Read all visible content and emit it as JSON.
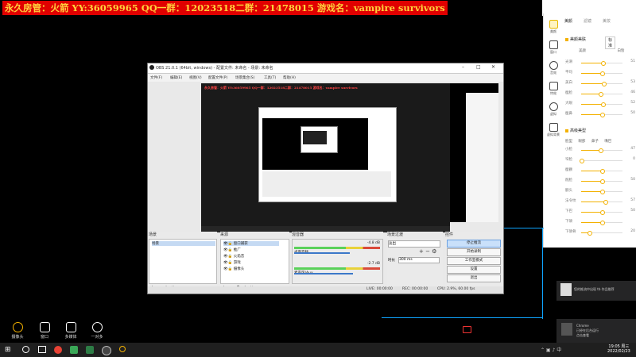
{
  "overlay": {
    "title": "永久房管：火箭 YY:36059965 QQ一群：12023518二群：21478015 游戏名：vampire survivors"
  },
  "beauty_panel": {
    "tabs": [
      "美颜",
      "滤镜",
      "美妆"
    ],
    "side_icons": [
      {
        "name": "美颜",
        "icon": "face-icon"
      },
      {
        "name": "窗口",
        "icon": "layers-icon"
      },
      {
        "name": "音效",
        "icon": "clock-icon"
      },
      {
        "name": "特效",
        "icon": "magic-wand-icon"
      },
      {
        "name": "虚拟",
        "icon": "person-icon"
      },
      {
        "name": "虚拟背景",
        "icon": "virtual-bg-icon"
      }
    ],
    "section1": {
      "label": "美颜美肤",
      "select": "标准"
    },
    "section1_toggle_labels": [
      "美颜",
      "白皙"
    ],
    "section1_sliders": [
      {
        "label": "光滑",
        "value": "51"
      },
      {
        "label": "平均",
        "value": ""
      },
      {
        "label": "美白",
        "value": "53"
      },
      {
        "label": "瘦脸",
        "value": "46"
      },
      {
        "label": "大眼",
        "value": "52"
      },
      {
        "label": "瘦鼻",
        "value": "50"
      }
    ],
    "section2": {
      "label": "高级美型"
    },
    "section2_tabs": [
      "脸型",
      "眼部",
      "鼻子",
      "嘴巴"
    ],
    "section2_sliders": [
      {
        "label": "小脸",
        "value": "47"
      },
      {
        "label": "窄脸",
        "value": "0"
      },
      {
        "label": "瘦颧",
        "value": ""
      },
      {
        "label": "削脸",
        "value": "50"
      },
      {
        "label": "额头",
        "value": ""
      },
      {
        "label": "法令纹",
        "value": "57"
      },
      {
        "label": "下巴",
        "value": "50"
      },
      {
        "label": "下颌",
        "value": ""
      },
      {
        "label": "下颌骨",
        "value": "20"
      }
    ]
  },
  "obs": {
    "title": "OBS 21.0.1 (64bit, windows) - 配置文件: 未命名 - 场景: 未命名",
    "menu": [
      "文件(F)",
      "编辑(E)",
      "视图(V)",
      "配置文件(P)",
      "场景集合(S)",
      "工具(T)",
      "帮助(H)"
    ],
    "preview_banner": "永久房管：火箭 YY:36059965 QQ一群：12023518二群：21478015 游戏名：vampire survivors",
    "docks": {
      "scenes": {
        "title": "场景",
        "items": [
          "场景"
        ]
      },
      "sources": {
        "title": "来源",
        "items": [
          "窗口捕获",
          "推广",
          "火焰音",
          "游戏",
          "摄像头"
        ]
      },
      "mixer": {
        "title": "混音器",
        "channels": [
          {
            "name": "桌面音频",
            "db": "-4.8 dB"
          },
          {
            "name": "麦克风/Aux",
            "db": "-2.7 dB"
          }
        ]
      },
      "transitions": {
        "title": "场景过渡",
        "type": "淡出",
        "duration_label": "时长",
        "duration": "300 ms"
      },
      "controls": {
        "title": "控件",
        "buttons": [
          "停止推流",
          "开始录制",
          "工作室模式",
          "设置",
          "退出"
        ]
      }
    },
    "status": {
      "live": "LIVE: 00:00:00",
      "rec": "REC: 00:00:00",
      "cpu": "CPU: 2.9%, 60.00 fps"
    }
  },
  "notifications": [
    {
      "text": "您的推流中出现 tb 作品推荐"
    },
    {
      "lines": [
        "Chrome",
        "已经在后台运行",
        "点击查看"
      ]
    }
  ],
  "toolbar": {
    "items": [
      "摄像头",
      "窗口",
      "多媒体",
      "一对多"
    ]
  },
  "taskbar": {
    "time": "19:05 周三",
    "date": "2022/02/23"
  },
  "colors": {
    "overlay_text": "#ffd23c",
    "overlay_bg": "#e00000",
    "accent": "#f3b100",
    "selection_frame": "#0ea5ff"
  }
}
